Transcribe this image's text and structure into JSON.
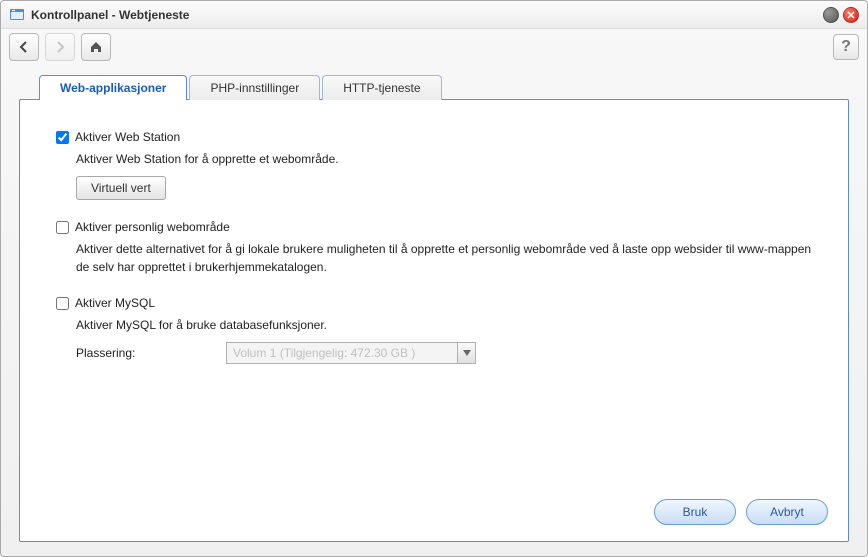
{
  "window": {
    "title": "Kontrollpanel - Webtjeneste"
  },
  "tabs": [
    {
      "label": "Web-applikasjoner",
      "active": true
    },
    {
      "label": "PHP-innstillinger",
      "active": false
    },
    {
      "label": "HTTP-tjeneste",
      "active": false
    }
  ],
  "options": {
    "webstation": {
      "label": "Aktiver Web Station",
      "checked": true,
      "desc": "Aktiver Web Station for å opprette et webområde.",
      "button": "Virtuell vert"
    },
    "personal": {
      "label": "Aktiver personlig webområde",
      "checked": false,
      "desc": "Aktiver dette alternativet for å gi lokale brukere muligheten til å opprette et personlig webområde ved å laste opp websider til www-mappen de selv har opprettet i brukerhjemmekatalogen."
    },
    "mysql": {
      "label": "Aktiver MySQL",
      "checked": false,
      "desc": "Aktiver MySQL for å bruke databasefunksjoner.",
      "locationLabel": "Plassering:",
      "locationValue": "Volum 1 (Tilgjengelig: 472.30 GB )"
    }
  },
  "buttons": {
    "apply": "Bruk",
    "cancel": "Avbryt"
  }
}
